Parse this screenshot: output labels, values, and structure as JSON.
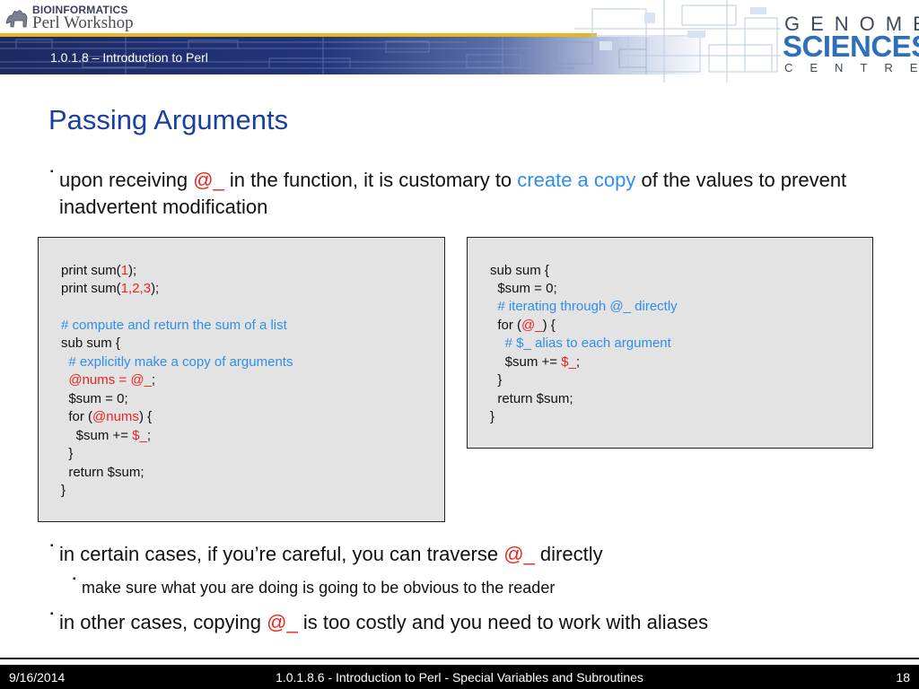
{
  "header": {
    "logo_line1": "BIOINFORMATICS",
    "logo_line2": "Perl Workshop",
    "breadcrumb": "1.0.1.8 – Introduction to Perl",
    "brand_genome": "GENOME",
    "brand_sciences": "SCIENCES",
    "brand_centre": "CENTRE"
  },
  "slide": {
    "title": "Passing Arguments",
    "bullet1": {
      "t1": "upon receiving ",
      "t2": "@_",
      "t3": " in the function, it is customary to ",
      "t4": "create a copy",
      "t5": " of the values to prevent inadvertent modification"
    },
    "bullet2": {
      "t1": "in certain cases, if you’re careful, you can traverse ",
      "t2": "@_",
      "t3": " directly"
    },
    "bullet3": {
      "t1": "make sure what you are doing is going to be obvious to the reader"
    },
    "bullet4": {
      "t1": "in other cases, copying ",
      "t2": "@_",
      "t3": " is too costly and you need to work with aliases"
    }
  },
  "code_left": {
    "l1": [
      "print sum(",
      "1",
      ");"
    ],
    "l2": [
      "print sum(",
      "1,2,3",
      ");"
    ],
    "l3": "# compute and return the sum of a list",
    "l4": "sub sum {",
    "l5": "  # explicitly make a copy of arguments",
    "l6": [
      "  ",
      "@nums = @_",
      ";"
    ],
    "l7": "  $sum = 0;",
    "l8": [
      "  for (",
      "@nums",
      ") {"
    ],
    "l9": [
      "    $sum += ",
      "$_",
      ";"
    ],
    "l10": "  }",
    "l11": "  return $sum;",
    "l12": "}"
  },
  "code_right": {
    "l1": "sub sum {",
    "l2": "  $sum = 0;",
    "l3": "  # iterating through @_ directly",
    "l4": [
      "  for (",
      "@_",
      ") {"
    ],
    "l5": "    # $_ alias to each argument",
    "l6": [
      "    $sum += ",
      "$_",
      ";"
    ],
    "l7": "  }",
    "l8": "  return $sum;",
    "l9": "}"
  },
  "footer": {
    "date": "9/16/2014",
    "course": "1.0.1.8.6 - Introduction to Perl - Special Variables and Subroutines",
    "page": "18"
  },
  "colors": {
    "title": "#1a3fa0",
    "highlight_red": "#e8251f",
    "highlight_blue": "#2f8fe8",
    "band": "#1c2a63",
    "band_accent": "#e8b81b"
  }
}
